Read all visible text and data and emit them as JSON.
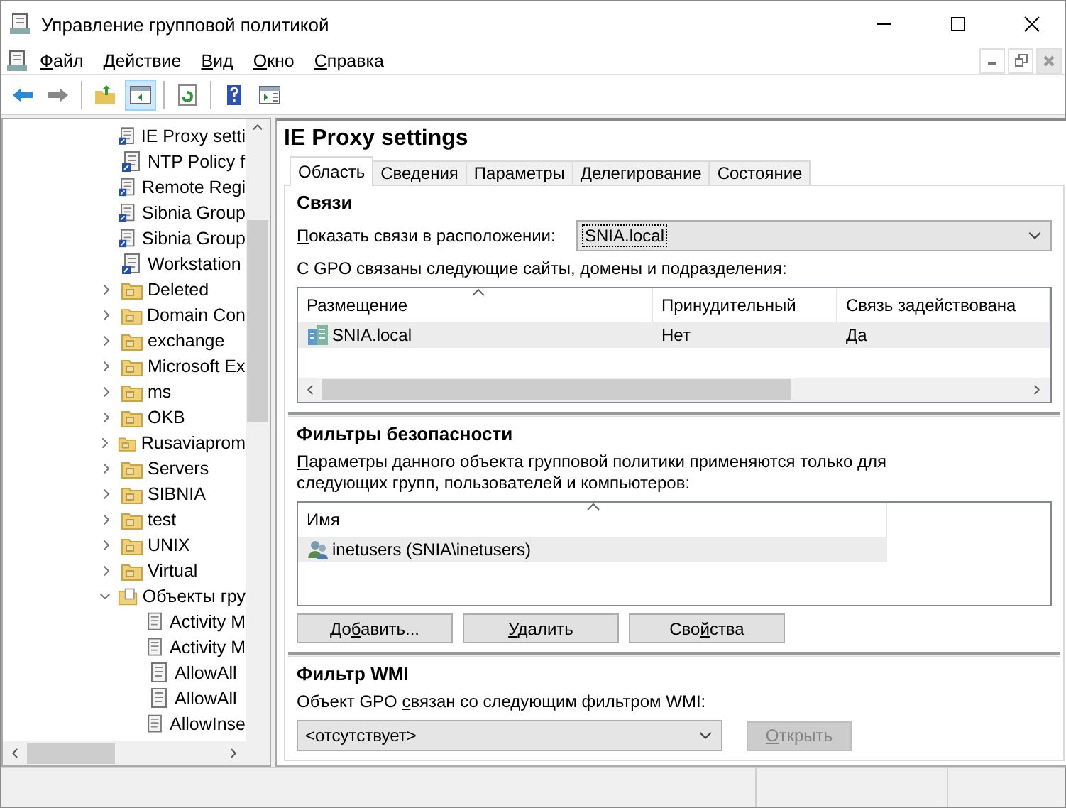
{
  "window": {
    "title": "Управление групповой политикой"
  },
  "menu": [
    {
      "key": "Ф",
      "post": "айл"
    },
    {
      "key": "Д",
      "post": "ействие"
    },
    {
      "key": "В",
      "post": "ид"
    },
    {
      "key": "О",
      "post": "кно"
    },
    {
      "key": "С",
      "post": "правка"
    }
  ],
  "toolbar": [
    {
      "kind": "back"
    },
    {
      "kind": "forward"
    },
    {
      "kind": "sep"
    },
    {
      "kind": "up"
    },
    {
      "kind": "tree",
      "selected": true
    },
    {
      "kind": "sep"
    },
    {
      "kind": "refresh"
    },
    {
      "kind": "sep"
    },
    {
      "kind": "help"
    },
    {
      "kind": "pane"
    }
  ],
  "tree": [
    {
      "kind": "link",
      "label": "IE Proxy setti"
    },
    {
      "kind": "link",
      "label": "NTP Policy f"
    },
    {
      "kind": "link",
      "label": "Remote Regi"
    },
    {
      "kind": "link",
      "label": "Sibnia Group"
    },
    {
      "kind": "link",
      "label": "Sibnia Group"
    },
    {
      "kind": "link",
      "label": "Workstation"
    },
    {
      "kind": "folder",
      "label": "Deleted",
      "expanded": false
    },
    {
      "kind": "folder",
      "label": "Domain Con",
      "expanded": false
    },
    {
      "kind": "folder",
      "label": "exchange",
      "expanded": false
    },
    {
      "kind": "folder",
      "label": "Microsoft Ex",
      "expanded": false
    },
    {
      "kind": "folder",
      "label": "ms",
      "expanded": false
    },
    {
      "kind": "folder",
      "label": "OKB",
      "expanded": false
    },
    {
      "kind": "folder",
      "label": "Rusaviaprom",
      "expanded": false
    },
    {
      "kind": "folder",
      "label": "Servers",
      "expanded": false
    },
    {
      "kind": "folder",
      "label": "SIBNIA",
      "expanded": false
    },
    {
      "kind": "folder",
      "label": "test",
      "expanded": false
    },
    {
      "kind": "folder",
      "label": "UNIX",
      "expanded": false
    },
    {
      "kind": "folder",
      "label": "Virtual",
      "expanded": false
    },
    {
      "kind": "gpofolder",
      "label": "Объекты гру",
      "expanded": true,
      "children": [
        {
          "kind": "gpo",
          "label": "Activity M"
        },
        {
          "kind": "gpo",
          "label": "Activity M"
        },
        {
          "kind": "gpo",
          "label": "AllowAll"
        },
        {
          "kind": "gpo",
          "label": "AllowAll"
        },
        {
          "kind": "gpo",
          "label": "AllowInse"
        }
      ]
    }
  ],
  "details": {
    "title": "IE Proxy settings",
    "tabs": [
      {
        "label": "Область",
        "selected": true
      },
      {
        "label": "Сведения",
        "selected": false
      },
      {
        "label": "Параметры",
        "selected": false
      },
      {
        "label": "Делегирование",
        "selected": false
      },
      {
        "label": "Состояние",
        "selected": false
      }
    ],
    "links": {
      "title": "Связи",
      "location_label": {
        "key": "П",
        "post": "оказать связи в расположении:"
      },
      "location_value": "SNIA.local",
      "intro": {
        "pre": "С GPO связаны следующие сайты, ",
        "key": "д",
        "post": "омены и подразделения:"
      },
      "columns": [
        "Размещение",
        "Принудительный",
        "Связь задействована"
      ],
      "rows": [
        {
          "cells": [
            "SNIA.local",
            "Нет",
            "Да"
          ],
          "selected": true
        }
      ]
    },
    "security": {
      "title": "Фильтры безопасности",
      "intro": {
        "key": "П",
        "post": "араметры данного объекта групповой политики применяются только для следующих групп, пользователей и компьютеров:"
      },
      "columns": [
        "Имя"
      ],
      "rows": [
        {
          "cells": [
            "inetusers (SNIA\\inetusers)"
          ],
          "selected": true
        }
      ],
      "buttons": [
        {
          "pre": "До",
          "key": "б",
          "post": "авить...",
          "disabled": false
        },
        {
          "key": "У",
          "post": "далить",
          "disabled": false
        },
        {
          "pre": "Сво",
          "key": "й",
          "post": "ства",
          "disabled": false
        }
      ]
    },
    "wmi": {
      "title": "Фильтр WMI",
      "label": {
        "pre": "Объект GPO ",
        "key": "с",
        "post": "вязан со следующим фильтром WMI:"
      },
      "value": "<отсутствует>",
      "button": {
        "key": "О",
        "post": "ткрыть",
        "disabled": true
      }
    }
  }
}
